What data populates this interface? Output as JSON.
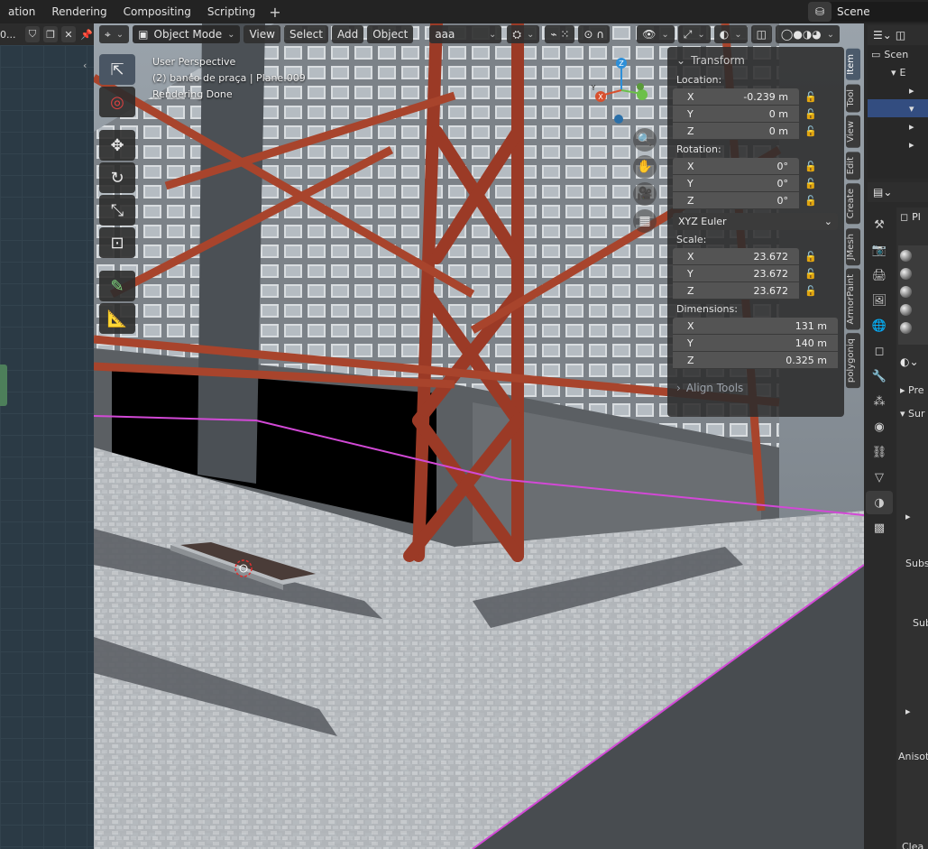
{
  "topbar": {
    "menus": [
      "ation",
      "Rendering",
      "Compositing",
      "Scripting"
    ],
    "add_workspace": "+",
    "scene_name": "Scene"
  },
  "left_editor": {
    "field_text": "0..."
  },
  "viewport": {
    "header": {
      "mode": "Object Mode",
      "menus": [
        "View",
        "Select",
        "Add",
        "Object"
      ],
      "layer_field": "aaa"
    },
    "info": {
      "perspective": "User Perspective",
      "object": "(2) banco de praça | Plane.009",
      "status": "Rendering Done"
    }
  },
  "npanel": {
    "section": "Transform",
    "location_label": "Location:",
    "location": [
      {
        "axis": "X",
        "value": "-0.239 m"
      },
      {
        "axis": "Y",
        "value": "0 m"
      },
      {
        "axis": "Z",
        "value": "0 m"
      }
    ],
    "rotation_label": "Rotation:",
    "rotation": [
      {
        "axis": "X",
        "value": "0°"
      },
      {
        "axis": "Y",
        "value": "0°"
      },
      {
        "axis": "Z",
        "value": "0°"
      }
    ],
    "rotation_mode": "XYZ Euler",
    "scale_label": "Scale:",
    "scale": [
      {
        "axis": "X",
        "value": "23.672"
      },
      {
        "axis": "Y",
        "value": "23.672"
      },
      {
        "axis": "Z",
        "value": "23.672"
      }
    ],
    "dimensions_label": "Dimensions:",
    "dimensions": [
      {
        "axis": "X",
        "value": "131 m"
      },
      {
        "axis": "Y",
        "value": "140 m"
      },
      {
        "axis": "Z",
        "value": "0.325 m"
      }
    ],
    "align_tools": "Align Tools"
  },
  "ntabs": [
    "Item",
    "Tool",
    "View",
    "Edit",
    "Create",
    "JMesh",
    "ArmorPaint",
    "polygoniq"
  ],
  "gizmo": {
    "x": "X",
    "y": "Y",
    "z": "Z"
  },
  "outliner": {
    "rows": [
      "Scen",
      "E",
      "",
      "",
      "",
      ""
    ]
  },
  "properties": {
    "header_text": "Pl",
    "texts": [
      "Pre",
      "Sur",
      "Subs",
      "Sub",
      "Anisot",
      "Clea"
    ],
    "colors": {
      "accent": "#4772b3",
      "selected_row": "#334d80"
    }
  }
}
